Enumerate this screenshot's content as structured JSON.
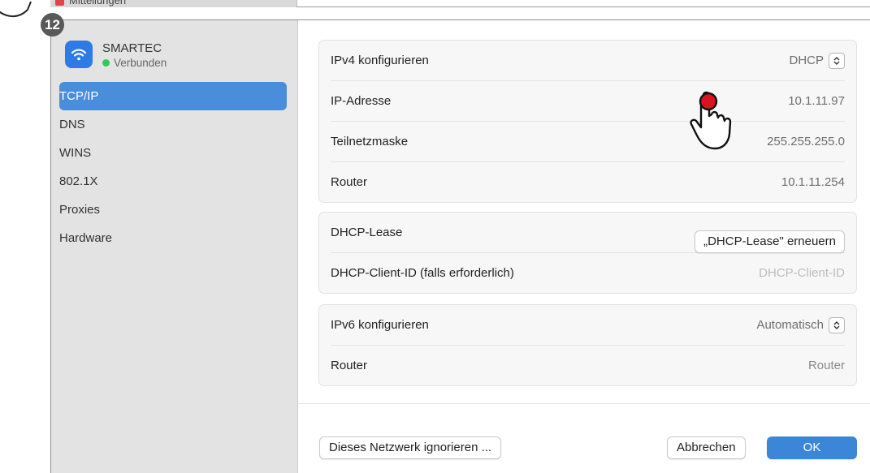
{
  "top_strip": {
    "partial_label": "Mitteilungen"
  },
  "step_badge": "12",
  "network": {
    "name": "SMARTEC",
    "status": "Verbunden"
  },
  "sidebar": {
    "items": [
      {
        "label": "TCP/IP",
        "active": true
      },
      {
        "label": "DNS",
        "active": false
      },
      {
        "label": "WINS",
        "active": false
      },
      {
        "label": "802.1X",
        "active": false
      },
      {
        "label": "Proxies",
        "active": false
      },
      {
        "label": "Hardware",
        "active": false
      }
    ]
  },
  "ipv4_group": {
    "configure_label": "IPv4 konfigurieren",
    "configure_value": "DHCP",
    "ip_label": "IP-Adresse",
    "ip_value": "10.1.11.97",
    "subnet_label": "Teilnetzmaske",
    "subnet_value": "255.255.255.0",
    "router_label": "Router",
    "router_value": "10.1.11.254"
  },
  "dhcp_group": {
    "lease_label": "DHCP-Lease",
    "renew_button": "„DHCP-Lease\" erneuern",
    "client_id_label": "DHCP-Client-ID (falls erforderlich)",
    "client_id_placeholder": "DHCP-Client-ID"
  },
  "ipv6_group": {
    "configure_label": "IPv6 konfigurieren",
    "configure_value": "Automatisch",
    "router_label": "Router",
    "router_placeholder": "Router"
  },
  "footer": {
    "ignore_button": "Dieses Netzwerk ignorieren ...",
    "cancel_button": "Abbrechen",
    "ok_button": "OK"
  },
  "icons": {
    "wifi": "wifi-icon",
    "popup_stepper": "chevron-up-down-icon",
    "hand": "hand-pointer-icon"
  },
  "colors": {
    "accent": "#3c86d8",
    "sidebar_selected": "#4a8edb",
    "status_green": "#34c759",
    "click_marker": "#d9141e"
  }
}
